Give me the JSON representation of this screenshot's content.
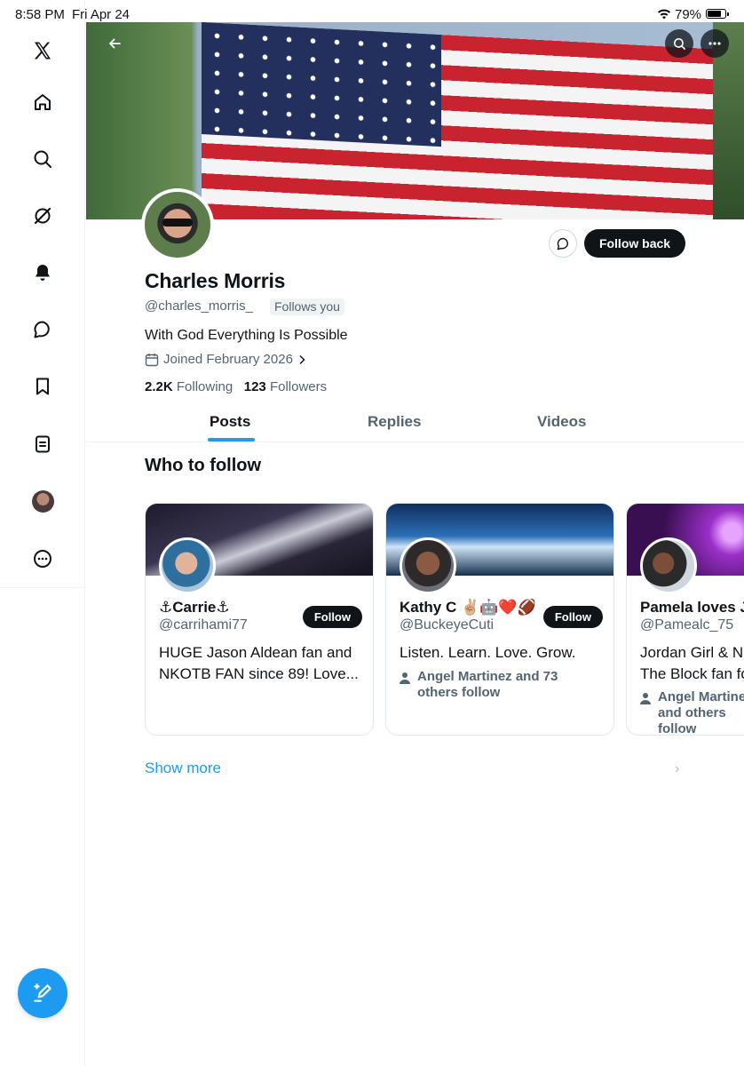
{
  "status_bar": {
    "time": "8:58 PM",
    "date": "Fri Apr 24",
    "battery_pct": "79%"
  },
  "sidebar": {
    "items": [
      "x-logo",
      "home",
      "search",
      "grok",
      "notifications",
      "messages",
      "bookmarks",
      "lists",
      "profile",
      "more"
    ]
  },
  "profile": {
    "name": "Charles Morris",
    "handle": "@charles_morris_",
    "follows_you": "Follows you",
    "bio": "With God Everything Is Possible",
    "joined": "Joined February 2026",
    "following_count": "2.2K",
    "following_label": "Following",
    "followers_count": "123",
    "followers_label": "Followers",
    "follow_back": "Follow back"
  },
  "tabs": [
    {
      "label": "Posts",
      "active": true
    },
    {
      "label": "Replies",
      "active": false
    },
    {
      "label": "Videos",
      "active": false
    }
  ],
  "who_to_follow": {
    "title": "Who to follow",
    "follow_label": "Follow",
    "cards": [
      {
        "name": "⚓Carrie⚓",
        "handle": "@carrihami77",
        "bio": "HUGE Jason Aldean fan and NKOTB FAN since 89! Love...",
        "social": ""
      },
      {
        "name": "Kathy C ✌🏼🤖❤️🏈",
        "handle": "@BuckeyeCuti",
        "bio": "Listen. Learn. Love. Grow.",
        "social": "Angel Martinez and 73 others follow"
      },
      {
        "name": "Pamela loves Jordan",
        "handle": "@Pamealc_75",
        "bio": "Jordan Girl & New Kids On The Block fan for Life",
        "social": "Angel Martinez and others follow"
      }
    ],
    "show_more": "Show more"
  },
  "colors": {
    "accent": "#1d9bf0",
    "text": "#0f1419",
    "muted": "#536471"
  }
}
